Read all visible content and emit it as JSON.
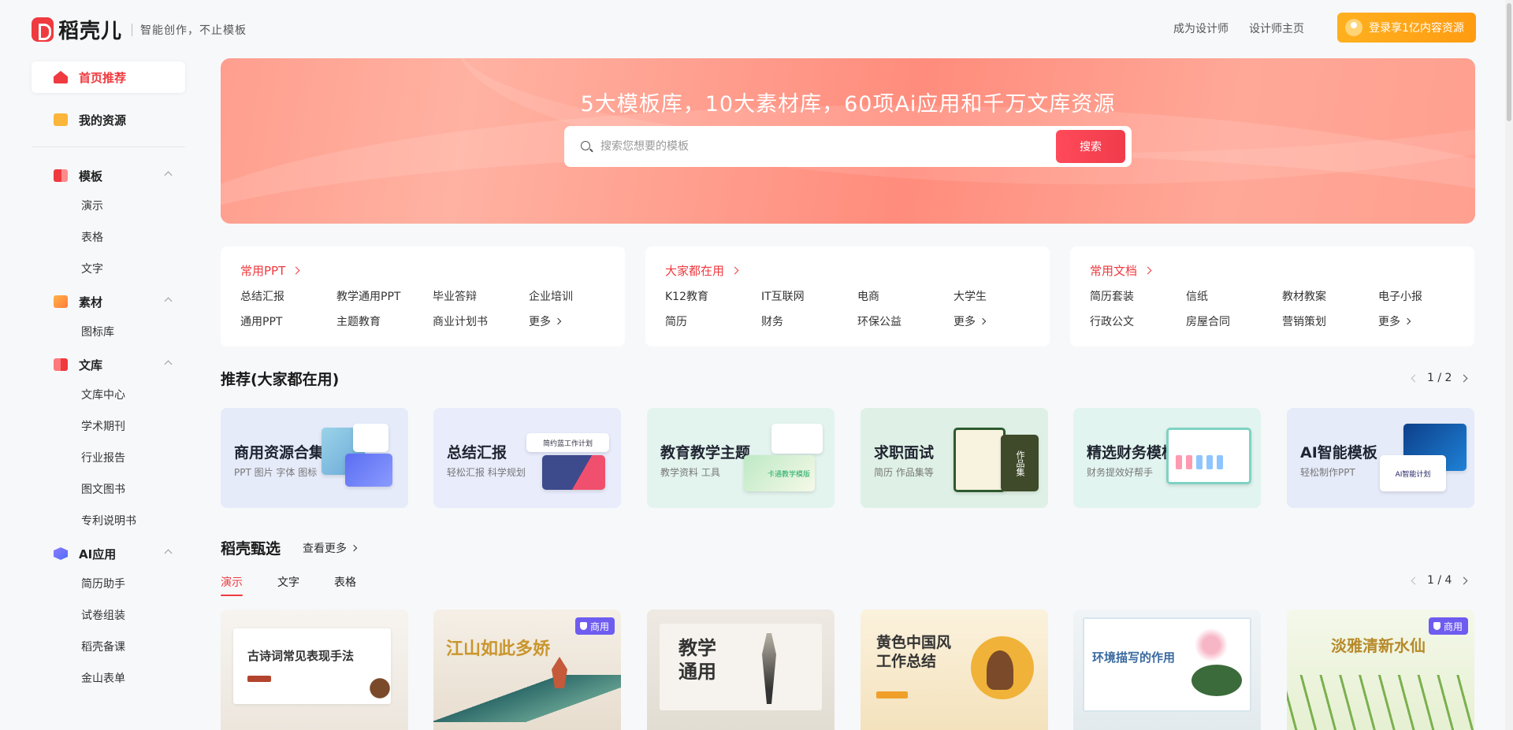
{
  "header": {
    "logo_text": "稻壳儿",
    "slogan": "智能创作，不止模板",
    "links": [
      "成为设计师",
      "设计师主页"
    ],
    "login_label": "登录享1亿内容资源"
  },
  "sidebar": {
    "home": "首页推荐",
    "resources": "我的资源",
    "groups": [
      {
        "title": "模板",
        "items": [
          "演示",
          "表格",
          "文字"
        ]
      },
      {
        "title": "素材",
        "items": [
          "图标库"
        ]
      },
      {
        "title": "文库",
        "items": [
          "文库中心",
          "学术期刊",
          "行业报告",
          "图文图书",
          "专利说明书"
        ]
      },
      {
        "title": "AI应用",
        "items": [
          "简历助手",
          "试卷组装",
          "稻壳备课",
          "金山表单"
        ]
      }
    ]
  },
  "banner": {
    "title": "5大模板库，10大素材库，60项Ai应用和千万文库资源",
    "search_placeholder": "搜索您想要的模板",
    "search_button": "搜索"
  },
  "categories": [
    {
      "title": "常用PPT",
      "items": [
        "总结汇报",
        "教学通用PPT",
        "毕业答辩",
        "企业培训",
        "通用PPT",
        "主题教育",
        "商业计划书"
      ],
      "more": "更多"
    },
    {
      "title": "大家都在用",
      "items": [
        "K12教育",
        "IT互联网",
        "电商",
        "大学生",
        "简历",
        "财务",
        "环保公益"
      ],
      "more": "更多"
    },
    {
      "title": "常用文档",
      "items": [
        "简历套装",
        "信纸",
        "教材教案",
        "电子小报",
        "行政公文",
        "房屋合同",
        "营销策划"
      ],
      "more": "更多"
    }
  ],
  "recommend": {
    "title": "推荐(大家都在用)",
    "pager": "1 / 2",
    "cards": [
      {
        "title": "商用资源合集",
        "sub": "PPT 图片 字体 图标",
        "bg": "#e6ebfa",
        "mini": ""
      },
      {
        "title": "总结汇报",
        "sub": "轻松汇报 科学规划",
        "bg": "#e8ecfb",
        "mini": "简约蓝工作计划"
      },
      {
        "title": "教育教学主题",
        "sub": "教学资料 工具",
        "bg": "#e3f4ef",
        "mini": "卡通教学模版"
      },
      {
        "title": "求职面试",
        "sub": "简历 作品集等",
        "bg": "#dff1e6",
        "mini": "作品集"
      },
      {
        "title": "精选财务模板",
        "sub": "财务提效好帮手",
        "bg": "#e2f4ef",
        "mini": ""
      },
      {
        "title": "AI智能模板",
        "sub": "轻松制作PPT",
        "bg": "#e6ebfa",
        "mini": "AI智能计划"
      }
    ]
  },
  "picks": {
    "title": "稻壳甄选",
    "more": "查看更多",
    "tabs": [
      "演示",
      "文字",
      "表格"
    ],
    "pager": "1 / 4",
    "badge": "商用",
    "templates": [
      {
        "text": "古诗词常见表现手法"
      },
      {
        "text": "江山如此多娇"
      },
      {
        "text": "教学通用"
      },
      {
        "text": "黄色中国风工作总结"
      },
      {
        "text": "环境描写的作用"
      },
      {
        "text": "淡雅清新水仙"
      }
    ]
  }
}
